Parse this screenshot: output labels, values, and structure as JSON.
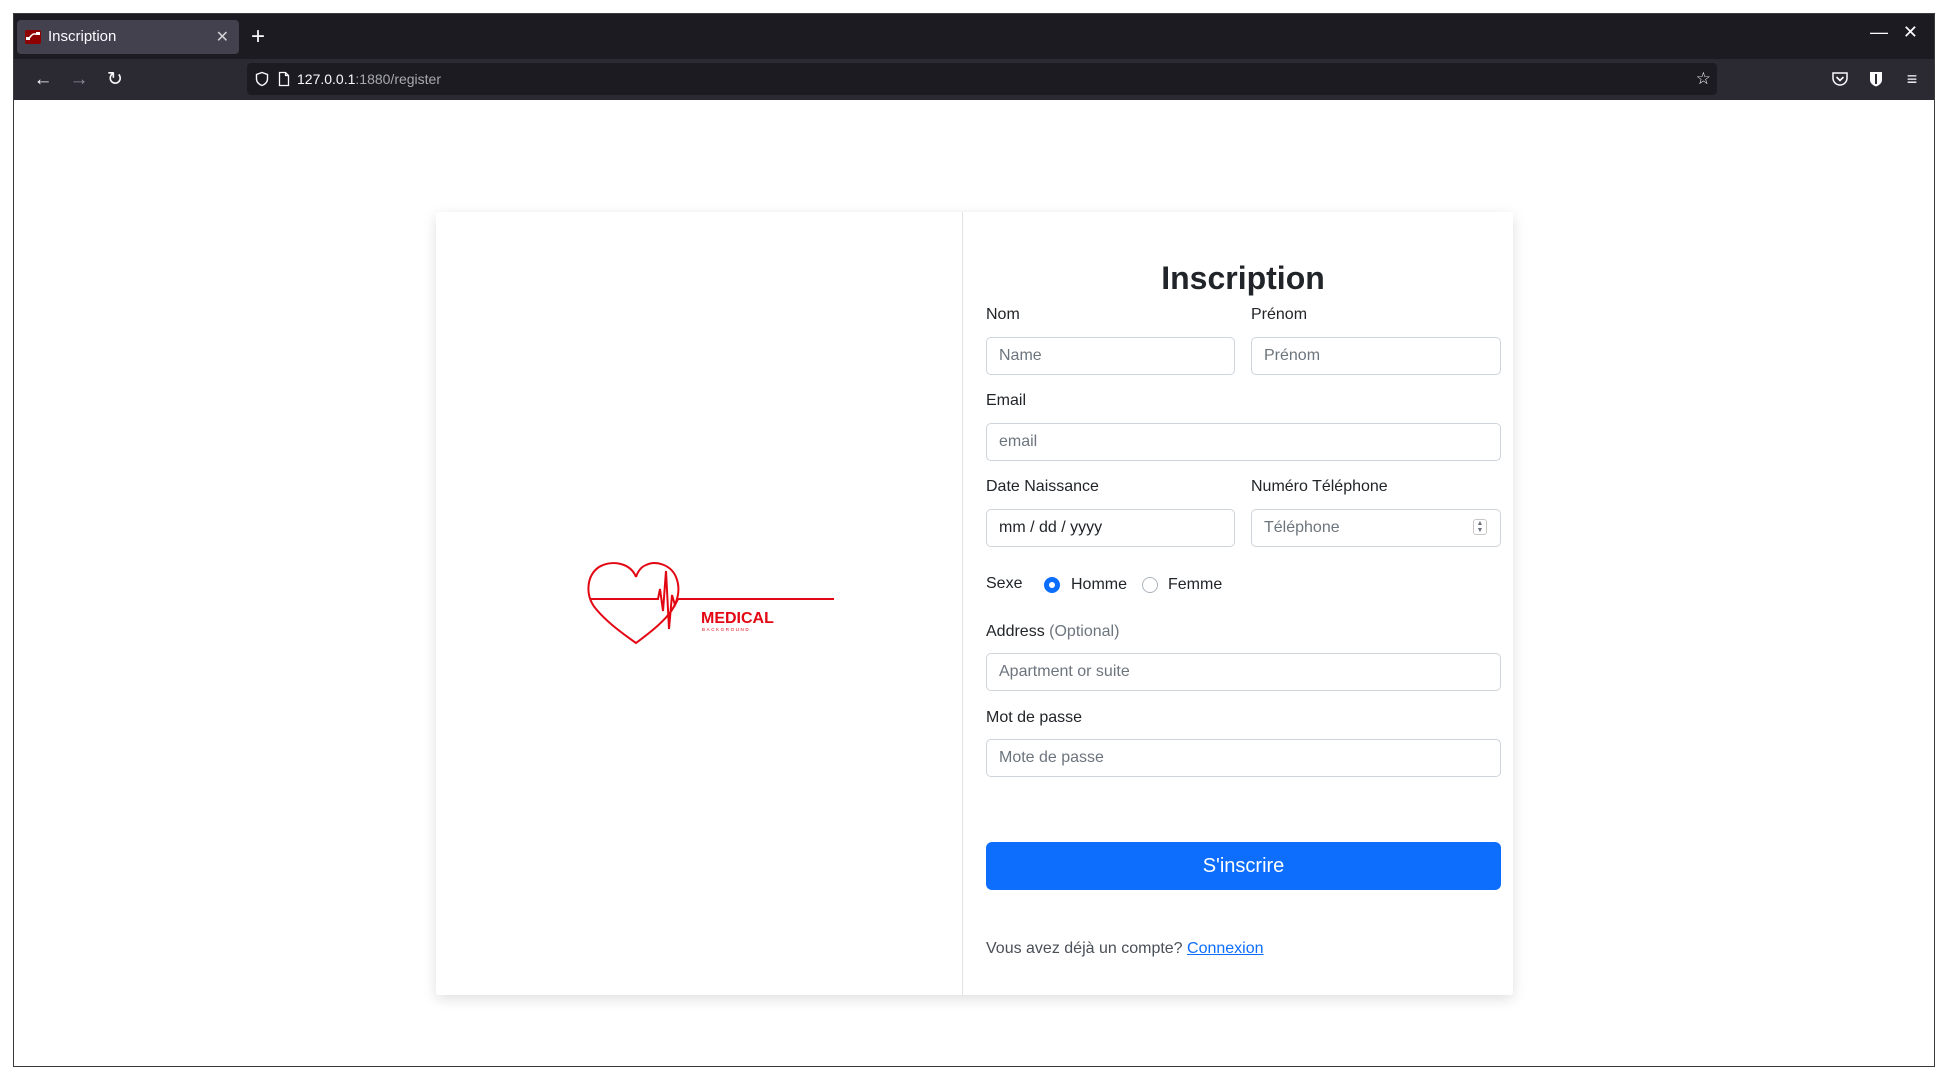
{
  "browser": {
    "tab_title": "Inscription",
    "url_host": "127.0.0.1",
    "url_path": ":1880/register"
  },
  "logo": {
    "text": "MEDICAL",
    "subtext": "BACKGROUND",
    "color": "#e30613"
  },
  "form": {
    "title": "Inscription",
    "nom_label": "Nom",
    "nom_placeholder": "Name",
    "prenom_label": "Prénom",
    "prenom_placeholder": "Prénom",
    "email_label": "Email",
    "email_placeholder": "email",
    "date_label": "Date Naissance",
    "date_value": "mm / dd / yyyy",
    "phone_label": "Numéro Téléphone",
    "phone_placeholder": "Téléphone",
    "sexe_label": "Sexe",
    "sexe_options": [
      "Homme",
      "Femme"
    ],
    "sexe_selected": "Homme",
    "address_label": "Address",
    "address_optional": "(Optional)",
    "address_placeholder": "Apartment or suite",
    "password_label": "Mot de passe",
    "password_placeholder": "Mote de passe",
    "submit_label": "S'inscrire",
    "footer_text": "Vous avez déjà un compte?",
    "footer_link": "Connexion"
  },
  "colors": {
    "primary": "#0d6efd",
    "browser_dark": "#1c1b22",
    "toolbar": "#2b2a33"
  }
}
